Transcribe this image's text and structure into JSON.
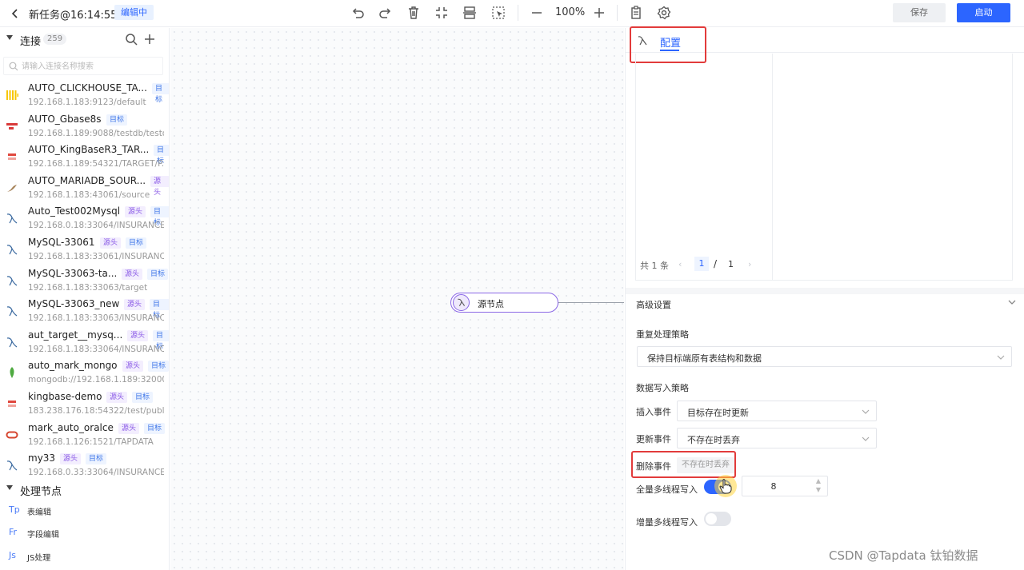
{
  "header": {
    "back_icon": "chevron-left-icon",
    "task_title": "新任务@16:14:55",
    "status_badge": "编辑中",
    "zoom": "100%",
    "save_label": "保存",
    "start_label": "启动",
    "tools": [
      "undo-icon",
      "redo-icon",
      "delete-icon",
      "fit-view-icon",
      "layout-icon",
      "select-icon",
      "zoom-out-icon",
      "zoom-in-icon",
      "clipboard-icon",
      "settings-icon"
    ]
  },
  "sidebar": {
    "connections_title": "连接",
    "connections_count": "259",
    "search_placeholder": "请输入连接名称搜索",
    "connections": [
      {
        "name": "AUTO_CLICKHOUSE_TA...",
        "addr": "192.168.1.183:9123/default",
        "tags": [
          "目标"
        ],
        "icon": "clickhouse-icon"
      },
      {
        "name": "AUTO_Gbase8s",
        "addr": "192.168.1.189:9088/testdb/testdb",
        "tags": [
          "目标"
        ],
        "icon": "gbase-icon"
      },
      {
        "name": "AUTO_KingBaseR3_TAR...",
        "addr": "192.168.1.189:54321/TARGET/P...",
        "tags": [
          "目标"
        ],
        "icon": "kingbase-icon"
      },
      {
        "name": "AUTO_MARIADB_SOUR...",
        "addr": "192.168.1.183:43061/source",
        "tags": [
          "源头"
        ],
        "icon": "mariadb-icon"
      },
      {
        "name": "Auto_Test002Mysql",
        "addr": "192.168.0.18:33064/INSURANCE",
        "tags": [
          "源头",
          "目标"
        ],
        "icon": "mysql-icon"
      },
      {
        "name": "MySQL-33061",
        "addr": "192.168.1.183:33061/INSURANCE",
        "tags": [
          "源头",
          "目标"
        ],
        "icon": "mysql-icon"
      },
      {
        "name": "MySQL-33063-ta...",
        "addr": "192.168.1.183:33063/target",
        "tags": [
          "源头",
          "目标"
        ],
        "icon": "mysql-icon"
      },
      {
        "name": "MySQL-33063_new",
        "addr": "192.168.1.183:33063/INSURANCE",
        "tags": [
          "源头",
          "目标"
        ],
        "icon": "mysql-icon"
      },
      {
        "name": "aut_target__mysq...",
        "addr": "192.168.1.183:33064/INSURANCE",
        "tags": [
          "源头",
          "目标"
        ],
        "icon": "mysql-icon"
      },
      {
        "name": "auto_mark_mongo",
        "addr": "mongodb://192.168.1.189:32000...",
        "tags": [
          "源头",
          "目标"
        ],
        "icon": "mongodb-icon"
      },
      {
        "name": "kingbase-demo",
        "addr": "183.238.176.18:54322/test/public",
        "tags": [
          "源头",
          "目标"
        ],
        "icon": "kingbase-icon"
      },
      {
        "name": "mark_auto_oralce",
        "addr": "192.168.1.126:1521/TAPDATA",
        "tags": [
          "源头",
          "目标"
        ],
        "icon": "oracle-icon"
      },
      {
        "name": "my33",
        "addr": "192.168.0.33:33064/INSURANCE",
        "tags": [
          "源头",
          "目标"
        ],
        "icon": "mysql-icon"
      }
    ],
    "processing_title": "处理节点",
    "processing_items": [
      {
        "icon_text": "Tp",
        "label": "表编辑"
      },
      {
        "icon_text": "Fr",
        "label": "字段编辑"
      },
      {
        "icon_text": "Js",
        "label": "JS处理"
      }
    ]
  },
  "canvas": {
    "node_label": "源节点",
    "node_icon": "mysql-icon"
  },
  "panel": {
    "tab_label": "配置",
    "pager": {
      "total_text": "共 1 条",
      "current": "1",
      "slash": "/",
      "total_pages": "1"
    },
    "advanced_title": "高级设置",
    "dup_strategy_label": "重复处理策略",
    "dup_strategy_value": "保持目标端原有表结构和数据",
    "write_strategy_label": "数据写入策略",
    "insert_label": "插入事件",
    "insert_value": "目标存在时更新",
    "update_label": "更新事件",
    "update_value": "不存在时丢弃",
    "delete_label": "删除事件",
    "delete_value": "不存在时丢弃",
    "full_multithread_label": "全量多线程写入",
    "full_multithread_on": true,
    "thread_count": "8",
    "incr_multithread_label": "增量多线程写入",
    "incr_multithread_on": false
  },
  "colors": {
    "primary": "#2c65ff",
    "highlight": "#e23b3b",
    "source_tag": "#8857e6",
    "target_tag": "#3f76e8"
  },
  "watermark": "CSDN @Tapdata 钛铂数据"
}
